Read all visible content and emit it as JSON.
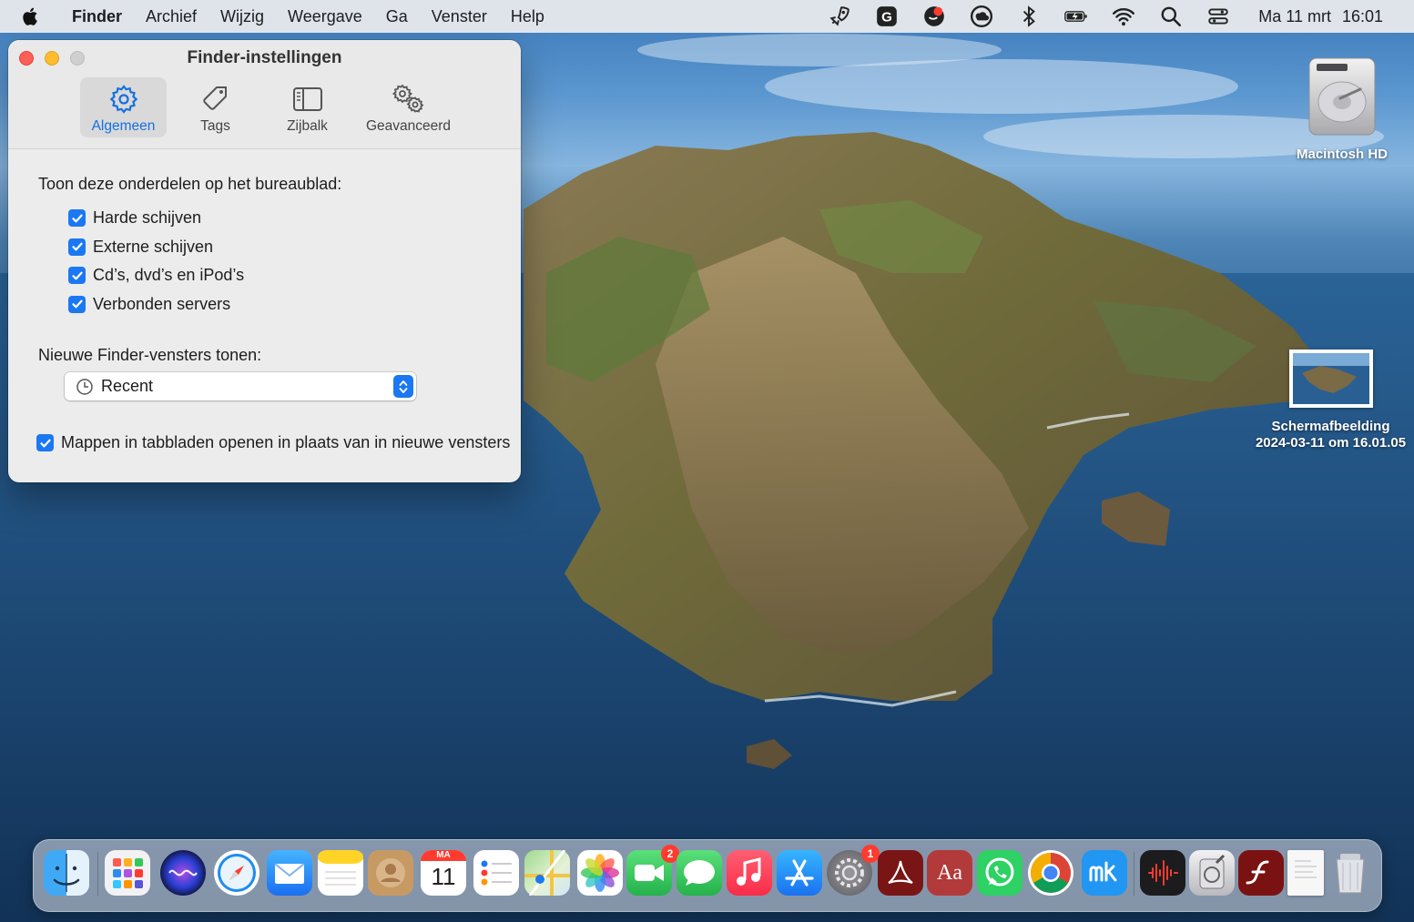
{
  "menubar": {
    "app_name": "Finder",
    "items": [
      "Archief",
      "Wijzig",
      "Weergave",
      "Ga",
      "Venster",
      "Help"
    ],
    "clock_day": "Ma 11 mrt",
    "clock_time": "16:01",
    "status_icons": [
      "rocket-icon",
      "grammarly-icon",
      "record-icon",
      "creative-cloud-icon",
      "bluetooth-icon",
      "battery-charging-icon",
      "wifi-icon",
      "search-icon",
      "control-center-icon"
    ]
  },
  "settings_window": {
    "title": "Finder-instellingen",
    "tabs": [
      {
        "label": "Algemeen",
        "icon": "gear-icon",
        "active": true
      },
      {
        "label": "Tags",
        "icon": "tag-icon",
        "active": false
      },
      {
        "label": "Zijbalk",
        "icon": "sidebar-icon",
        "active": false
      },
      {
        "label": "Geavanceerd",
        "icon": "gears-icon",
        "active": false
      }
    ],
    "desktop_section_label": "Toon deze onderdelen op het bureaublad:",
    "desktop_items": [
      {
        "label": "Harde schijven",
        "checked": true
      },
      {
        "label": "Externe schijven",
        "checked": true
      },
      {
        "label": "Cd’s, dvd’s en iPod’s",
        "checked": true
      },
      {
        "label": "Verbonden servers",
        "checked": true
      }
    ],
    "new_window_label": "Nieuwe Finder-vensters tonen:",
    "new_window_value": "Recent",
    "tabs_option": {
      "label": "Mappen in tabbladen openen in plaats van in nieuwe vensters",
      "checked": true
    }
  },
  "desktop_icons": {
    "hd_name": "Macintosh HD",
    "screenshot_name_line1": "Schermafbeelding",
    "screenshot_name_line2": "2024-03-11 om 16.01.05"
  },
  "dock": {
    "calendar_month": "MA",
    "calendar_day": "11",
    "facetime_badge": "2",
    "settings_badge": "1",
    "dictionary_label": "Aa",
    "apps": [
      "finder",
      "launchpad",
      "siri",
      "safari",
      "mail",
      "notes",
      "contacts",
      "calendar",
      "reminders",
      "maps",
      "photos",
      "facetime",
      "messages",
      "music",
      "app-store",
      "system-settings",
      "acrobat",
      "dictionary",
      "whatsapp",
      "chrome",
      "moneybird",
      "voice-memos",
      "disk-utility",
      "flash",
      "document",
      "trash"
    ]
  },
  "colors": {
    "accent": "#1b78f2",
    "close": "#fe5f57",
    "minimize": "#febc2e"
  }
}
